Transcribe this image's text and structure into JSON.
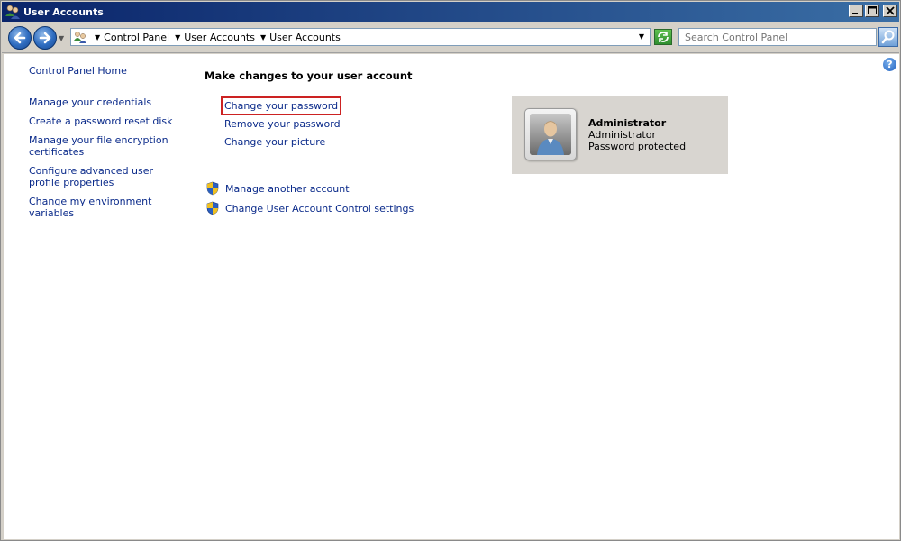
{
  "window": {
    "title": "User Accounts",
    "controls": {
      "minimize": "_",
      "maximize": "□",
      "close": "×"
    }
  },
  "navbar": {
    "back_icon": "back-arrow-icon",
    "forward_icon": "forward-arrow-icon",
    "breadcrumbs": [
      "Control Panel",
      "User Accounts",
      "User Accounts"
    ],
    "search_placeholder": "Search Control Panel"
  },
  "sidebar": {
    "home": "Control Panel Home",
    "items": [
      "Manage your credentials",
      "Create a password reset disk",
      "Manage your file encryption certificates",
      "Configure advanced user profile properties",
      "Change my environment variables"
    ]
  },
  "main": {
    "heading": "Make changes to your user account",
    "tasks": [
      "Change your password",
      "Remove your password",
      "Change your picture"
    ],
    "shield_tasks": [
      "Manage another account",
      "Change User Account Control settings"
    ]
  },
  "user": {
    "name": "Administrator",
    "role": "Administrator",
    "status": "Password protected"
  },
  "colors": {
    "link": "#0a2a8a",
    "titlebar_start": "#0a246a",
    "titlebar_end": "#3a6ea5",
    "highlight": "#cc2222"
  }
}
